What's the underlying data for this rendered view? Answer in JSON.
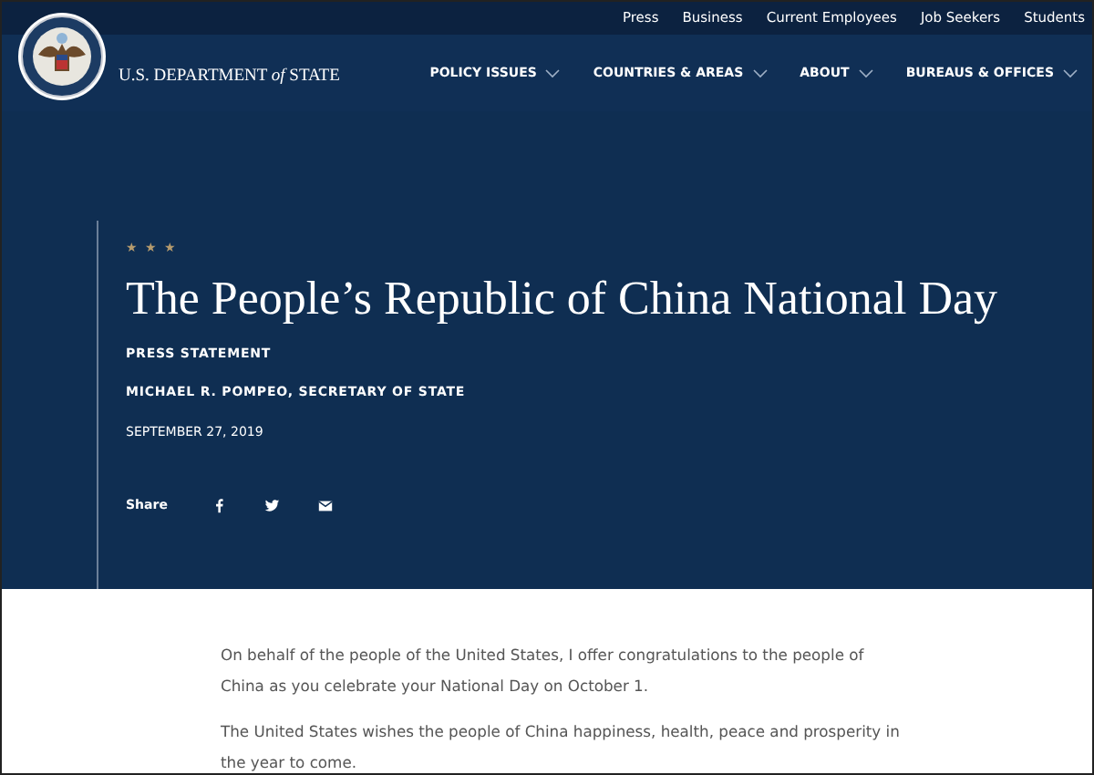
{
  "top_links": [
    "Press",
    "Business",
    "Current Employees",
    "Job Seekers",
    "Students"
  ],
  "logo": {
    "text": "U.S. DEPARTMENT *of* STATE"
  },
  "nav": [
    {
      "label": "POLICY ISSUES"
    },
    {
      "label": "COUNTRIES & AREAS"
    },
    {
      "label": "ABOUT"
    },
    {
      "label": "BUREAUS & OFFICES"
    }
  ],
  "hero": {
    "stars": "★ ★ ★",
    "title": "The People’s Republic of China National Day",
    "type": "PRESS STATEMENT",
    "author": "MICHAEL R. POMPEO, SECRETARY OF STATE",
    "date": "SEPTEMBER 27, 2019",
    "share_label": "Share",
    "share": [
      {
        "kind": "facebook"
      },
      {
        "kind": "twitter"
      },
      {
        "kind": "email"
      }
    ]
  },
  "body": [
    "On behalf of the people of the United States, I offer congratulations to the people of China as you celebrate your National Day on October 1.",
    "The United States wishes the people of China happiness, health, peace and prosperity in the year to come."
  ]
}
